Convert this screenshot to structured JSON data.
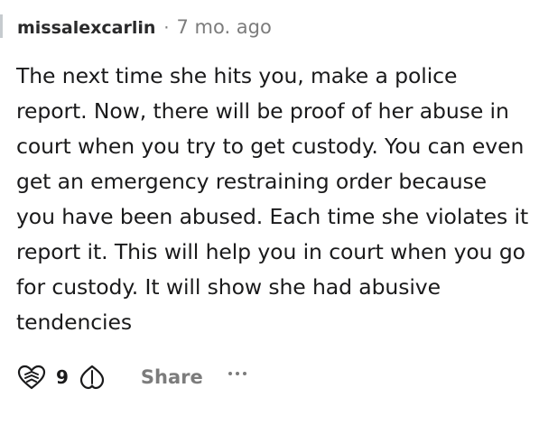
{
  "comment": {
    "author": "missalexcarlin",
    "separator": "·",
    "timestamp": "7 mo. ago",
    "body": "The next time she hits you, make a police report. Now, there will be proof of her abuse in court when you try to get custody. You can even get an emergency restraining order because you have been abused. Each time she violates it report it. This will help you in court when you go for custody. It will show she had abusive tendencies"
  },
  "actions": {
    "vote_count": "9",
    "share_label": "Share",
    "upvote_icon": "upvote-heart-icon",
    "downvote_icon": "downvote-icon",
    "more_icon": "more-options-icon"
  },
  "colors": {
    "text": "#1a1a1b",
    "muted": "#7c7c7c",
    "thread_line": "#c6cbcf"
  }
}
